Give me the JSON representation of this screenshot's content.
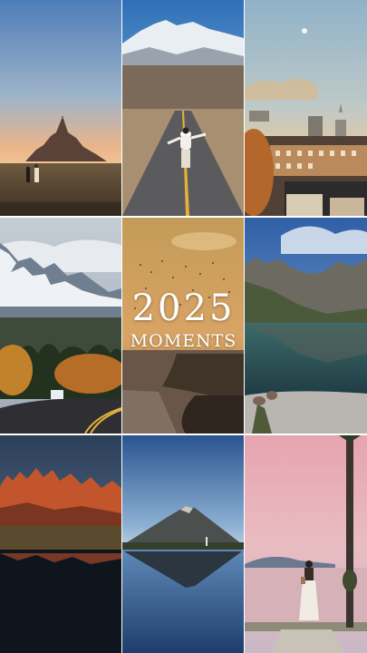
{
  "title": {
    "year": "2025",
    "subtitle": "MOMENTS"
  },
  "photos": [
    {
      "subject": "mont-saint-michel-sunset"
    },
    {
      "subject": "mountain-road-traveler"
    },
    {
      "subject": "city-rooftops-moon"
    },
    {
      "subject": "rockies-autumn-highway"
    },
    {
      "subject": "birds-over-sea-cliffs"
    },
    {
      "subject": "alpine-lake-reflection"
    },
    {
      "subject": "red-peaks-reflection"
    },
    {
      "subject": "volcano-lake-reflection"
    },
    {
      "subject": "seaside-walk-palm"
    }
  ]
}
